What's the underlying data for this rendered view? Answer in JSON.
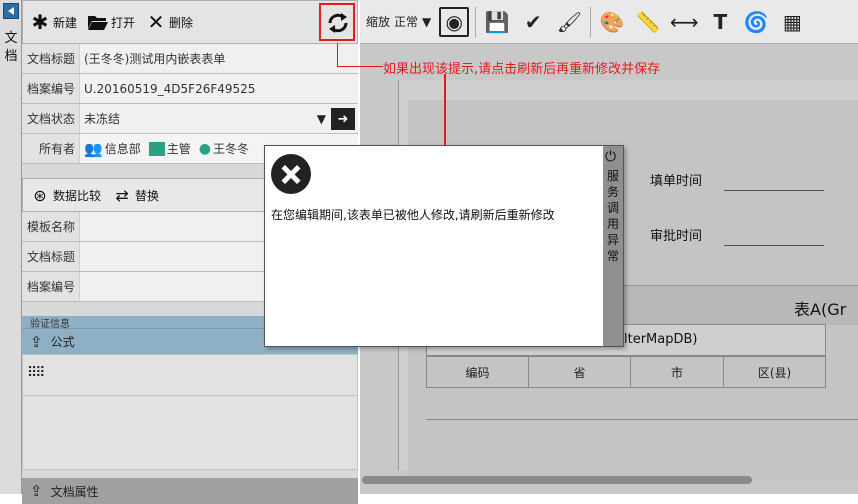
{
  "leftstrip": {
    "label": "文档"
  },
  "toolbar": {
    "new": "新建",
    "open": "打开",
    "delete": "删除"
  },
  "fields": [
    {
      "label": "文档标题",
      "value": "(王冬冬)测试用内嵌表表单"
    },
    {
      "label": "档案编号",
      "value": "U.20160519_4D5F26F49525"
    },
    {
      "label": "文档状态",
      "value": "未冻结"
    }
  ],
  "owner": {
    "label": "所有者",
    "dept": "信息部",
    "role": "主管",
    "user": "王冬冬"
  },
  "section2": {
    "compare": "数据比较",
    "replace": "替换"
  },
  "section2_rows": [
    "模板名称",
    "文档标题",
    "档案编号"
  ],
  "partial_label": "验证信息",
  "formula": {
    "label": "公式"
  },
  "doc_props": {
    "label": "文档属性"
  },
  "right_toolbar": {
    "zoom_label": "缩放",
    "zoom_value": "正常"
  },
  "annotation": "如果出现该提示,请点击刷新后再重新修改并保存",
  "dialog": {
    "message": "在您编辑期间,该表单已被他人修改,请刷新后重新修改",
    "side_label": "服务调用异常"
  },
  "form": {
    "fill_time": "填单时间",
    "approve_time": "审批时间",
    "table_title": "表A(Gr",
    "db_text": "lterMapDB)",
    "cols": [
      "编码",
      "省",
      "市",
      "区(县)"
    ]
  }
}
